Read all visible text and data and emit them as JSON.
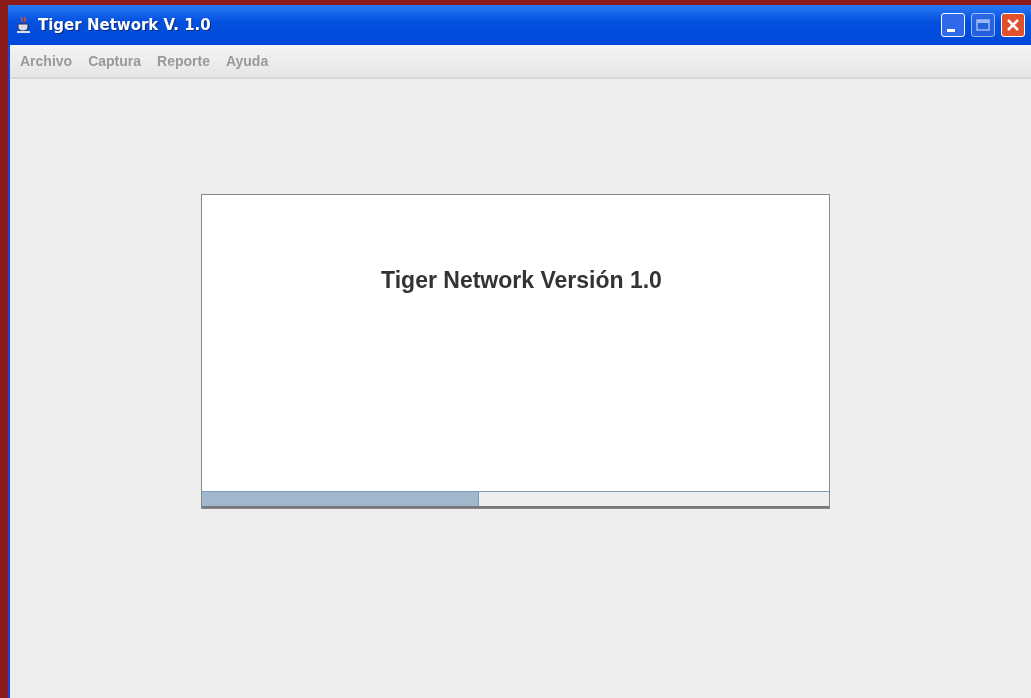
{
  "window": {
    "title": "Tiger Network V. 1.0"
  },
  "menu": [
    {
      "label": "Archivo",
      "disabled": true
    },
    {
      "label": "Captura",
      "disabled": true
    },
    {
      "label": "Reporte",
      "disabled": true
    },
    {
      "label": "Ayuda",
      "disabled": true
    }
  ],
  "splash": {
    "title": "Tiger Network Versión 1.0",
    "progress": {
      "level": 0.44
    }
  }
}
